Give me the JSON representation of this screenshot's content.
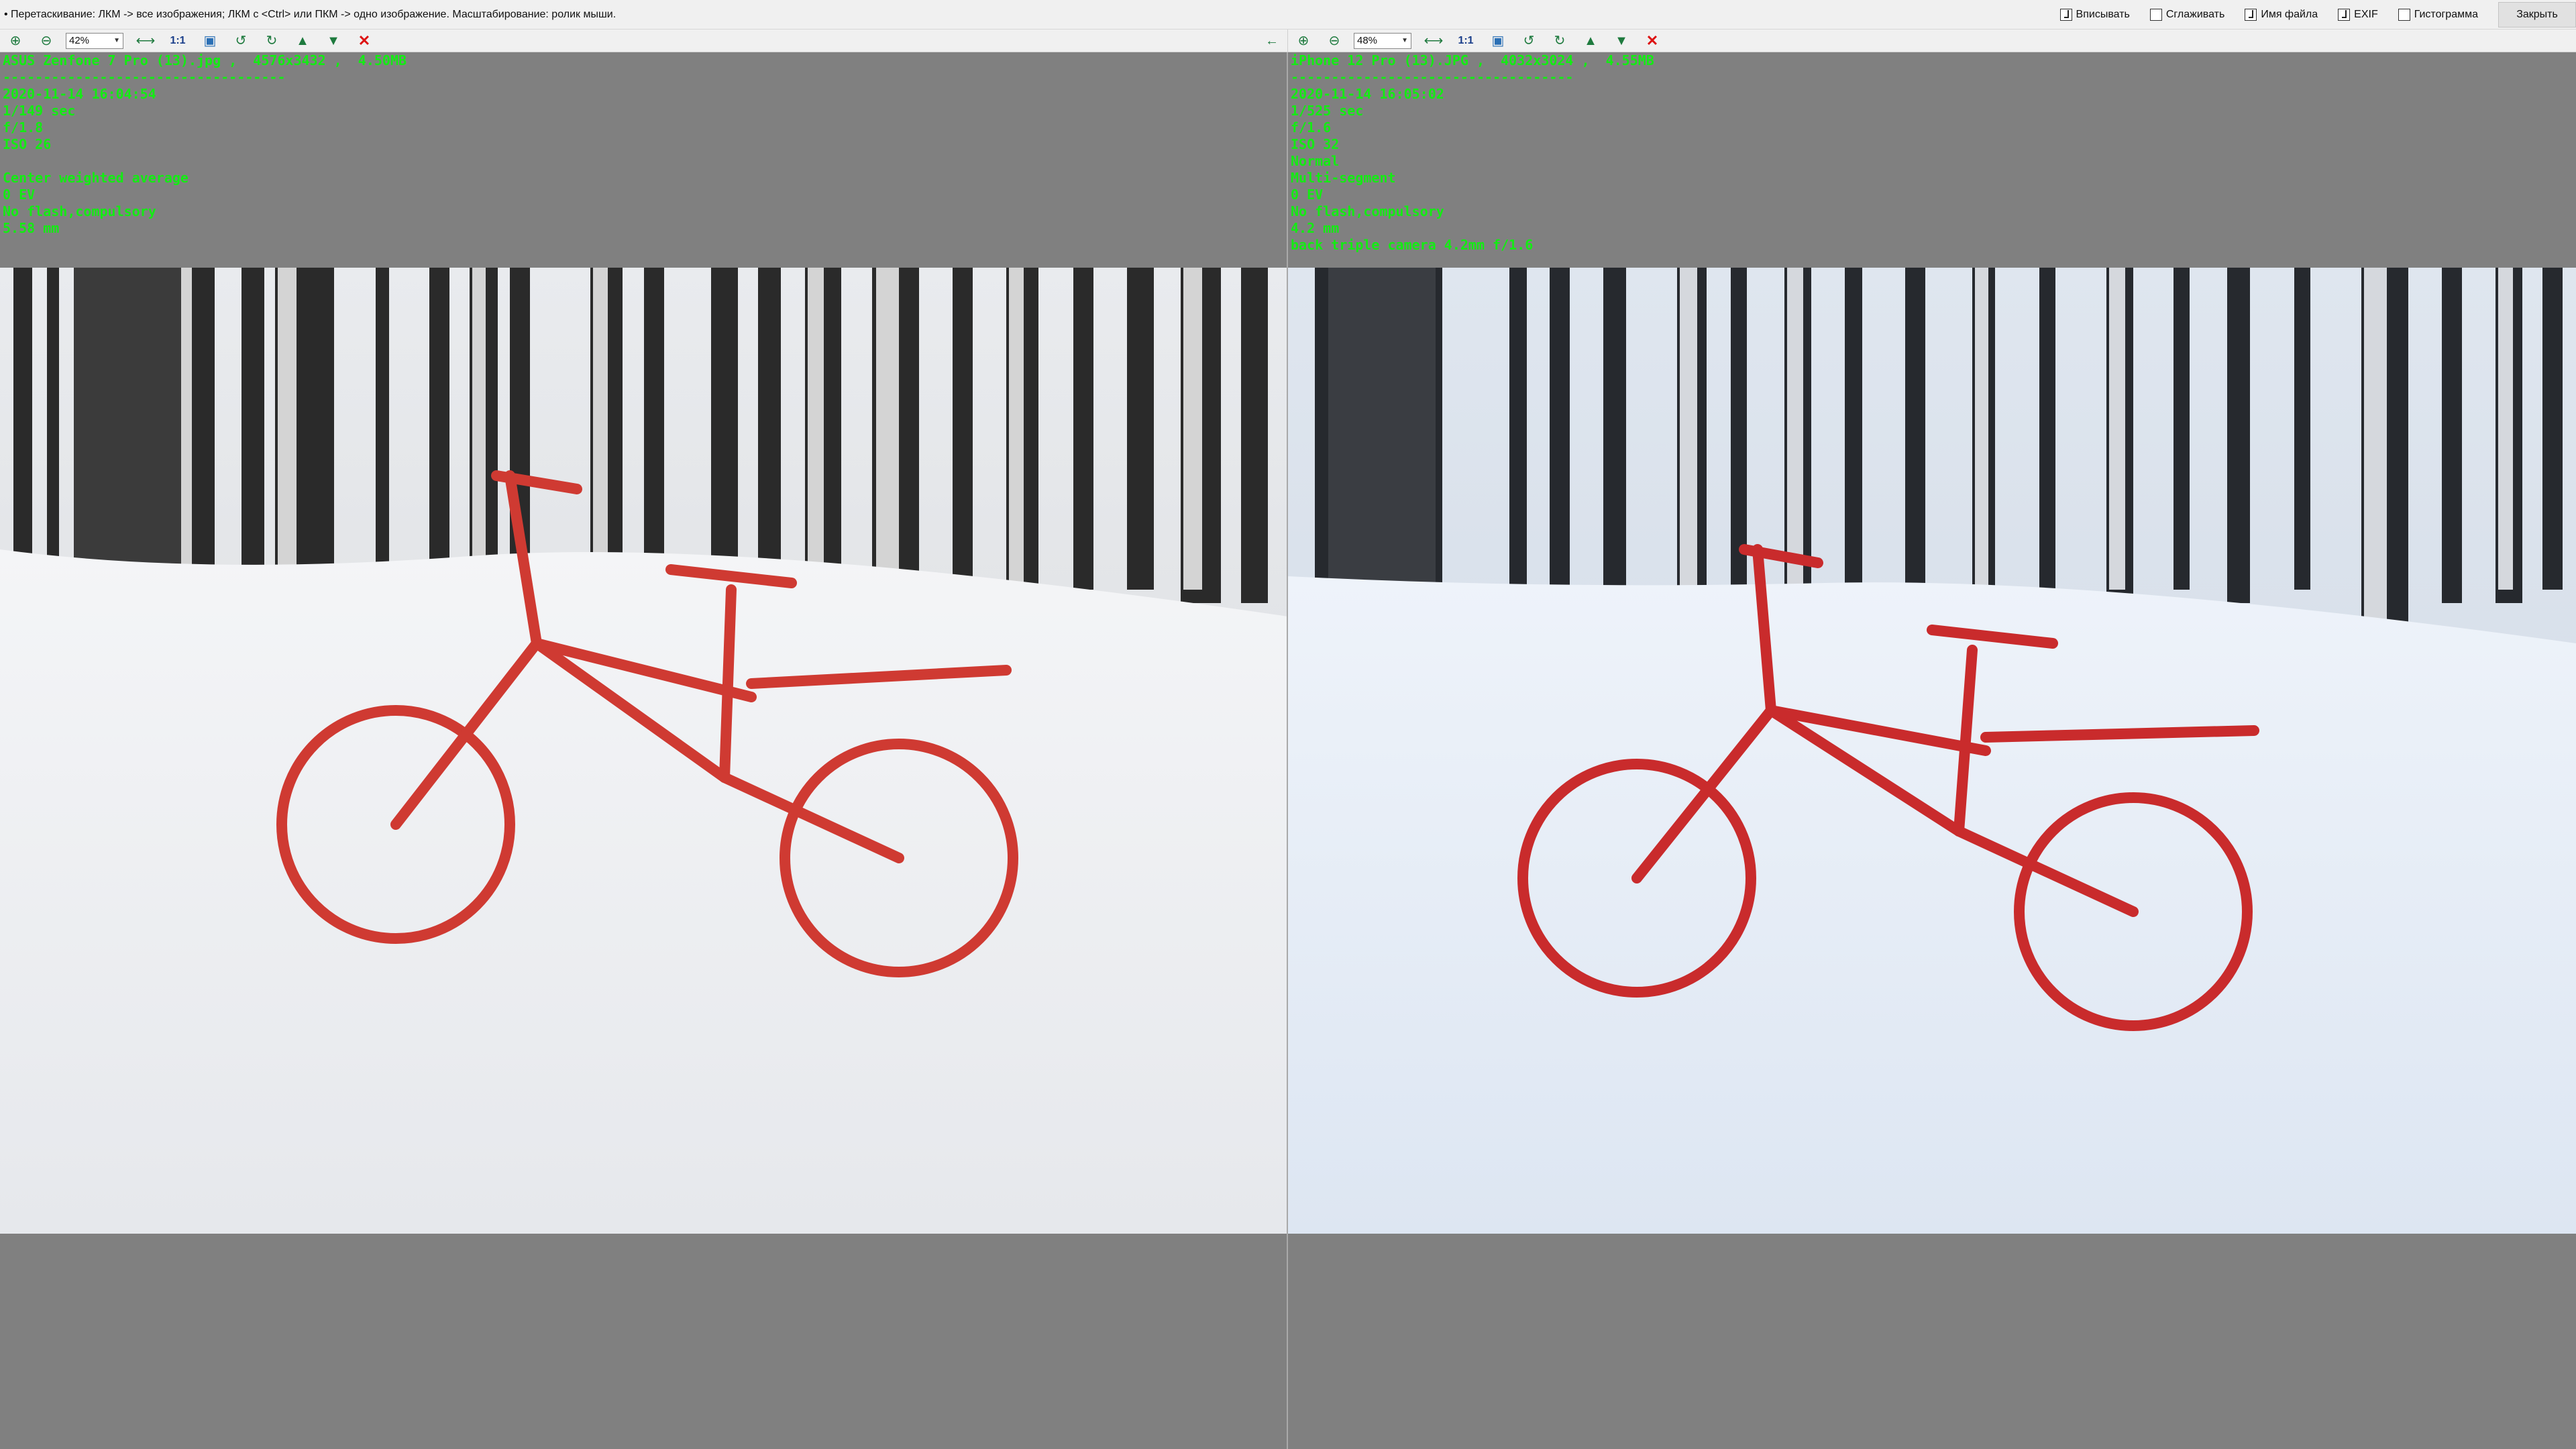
{
  "hint_text": "• Перетаскивание: ЛКМ -> все изображения; ЛКМ с <Ctrl> или ПКМ -> одно изображение. Масштабирование: ролик мыши.",
  "options": {
    "fit": {
      "label": "Вписывать",
      "checked": true
    },
    "smooth": {
      "label": "Сглаживать",
      "checked": false
    },
    "filename": {
      "label": "Имя файла",
      "checked": true
    },
    "exif": {
      "label": "EXIF",
      "checked": true
    },
    "histogram": {
      "label": "Гистограмма",
      "checked": false
    }
  },
  "close_label": "Закрыть",
  "left_pane": {
    "toolbar": {
      "zoom_in_icon": "zoom-in-icon",
      "zoom_out_icon": "zoom-out-icon",
      "zoom": "42%",
      "one_to_one": "1:1"
    },
    "exif_lines": [
      "ASUS Zenfone 7 Pro (13).jpg ,  4576x3432 ,  4.50MB",
      "-----------------------------------",
      "2020-11-14 16:04:54",
      "1/149 sec",
      "f/1.8",
      "ISO 26",
      "",
      "Center weighted average",
      "0 EV",
      "No flash,compulsory",
      "5.58 mm"
    ],
    "photo_caption": "Red bicycle in snow, birch forest"
  },
  "right_pane": {
    "toolbar": {
      "zoom": "48%",
      "one_to_one": "1:1"
    },
    "exif_lines": [
      "iPhone 12 Pro (13).JPG ,  4032x3024 ,  4.55MB",
      "-----------------------------------",
      "2020-11-14 16:05:02",
      "1/525 sec",
      "f/1.6",
      "ISO 32",
      "Normal",
      "Multi-segment",
      "0 EV",
      "No flash,compulsory",
      "4.2 mm",
      "back triple camera 4.2mm f/1.6"
    ]
  },
  "colors": {
    "exif_text": "#13ec13",
    "pane_background": "#808080",
    "bike_red_left": "#cf3a32",
    "bike_red_right": "#c92b2c"
  }
}
